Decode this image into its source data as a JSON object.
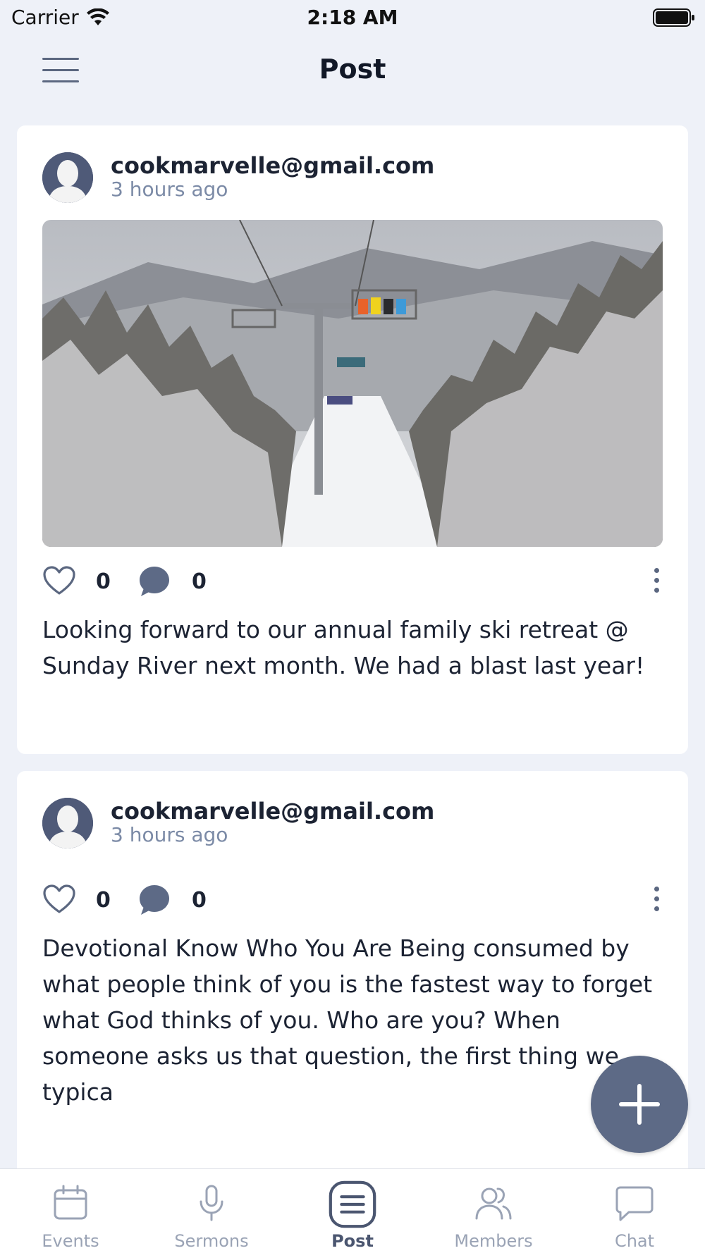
{
  "status_bar": {
    "carrier": "Carrier",
    "time": "2:18 AM"
  },
  "header": {
    "title": "Post"
  },
  "posts": [
    {
      "author": "cookmarvelle@gmail.com",
      "timestamp": "3 hours ago",
      "likes": "0",
      "comments": "0",
      "text": "Looking forward to our annual family ski retreat @ Sunday River next month.  We had a blast last year!",
      "has_image": true
    },
    {
      "author": "cookmarvelle@gmail.com",
      "timestamp": "3 hours ago",
      "likes": "0",
      "comments": "0",
      "text": "Devotional Know Who You Are Being consumed by what people think of you is the fastest way to forget what God thinks of you. Who are you? When someone asks us that question, the first thing we typica",
      "has_image": false
    }
  ],
  "tabs": [
    {
      "label": "Events",
      "icon": "calendar-icon",
      "active": false
    },
    {
      "label": "Sermons",
      "icon": "microphone-icon",
      "active": false
    },
    {
      "label": "Post",
      "icon": "post-list-icon",
      "active": true
    },
    {
      "label": "Members",
      "icon": "members-icon",
      "active": false
    },
    {
      "label": "Chat",
      "icon": "chat-bubble-icon",
      "active": false
    }
  ],
  "colors": {
    "accent": "#5d6a86",
    "background": "#eef1f8",
    "muted_text": "#7b8aa6"
  }
}
